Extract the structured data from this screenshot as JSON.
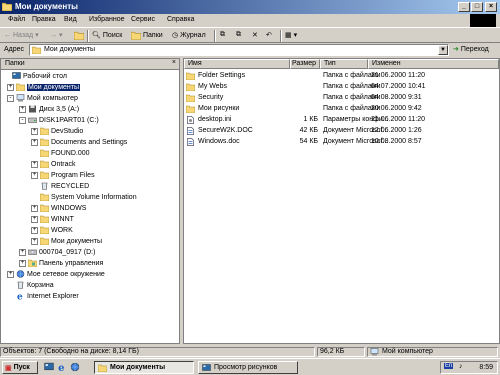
{
  "window": {
    "title": "Мои документы"
  },
  "menu": [
    "Файл",
    "Правка",
    "Вид",
    "Избранное",
    "Сервис",
    "Справка"
  ],
  "toolbar": {
    "back": "Назад",
    "search": "Поиск",
    "folders": "Папки",
    "history": "Журнал"
  },
  "address": {
    "label": "Адрес",
    "value": "Мои документы",
    "go": "Переход"
  },
  "folders_pane": {
    "title": "Папки"
  },
  "tree": [
    {
      "label": "Рабочий стол",
      "icon": "desktop-icon",
      "expander": ""
    },
    {
      "label": "Мои документы",
      "icon": "folder-icon",
      "expander": "+"
    },
    {
      "label": "Мой компьютер",
      "icon": "computer-icon",
      "expander": "-"
    },
    {
      "label": "Диск 3,5 (A:)",
      "icon": "floppy-icon",
      "expander": "+"
    },
    {
      "label": "DISK1PART01 (C:)",
      "icon": "drive-icon",
      "expander": "-"
    },
    {
      "label": "DevStudio",
      "icon": "folder-icon",
      "expander": "+"
    },
    {
      "label": "Documents and Settings",
      "icon": "folder-icon",
      "expander": "+"
    },
    {
      "label": "FOUND.000",
      "icon": "folder-icon",
      "expander": ""
    },
    {
      "label": "Ontrack",
      "icon": "folder-icon",
      "expander": "+"
    },
    {
      "label": "Program Files",
      "icon": "folder-icon",
      "expander": "+"
    },
    {
      "label": "RECYCLED",
      "icon": "recycle-icon",
      "expander": ""
    },
    {
      "label": "System Volume Information",
      "icon": "folder-icon",
      "expander": ""
    },
    {
      "label": "WINDOWS",
      "icon": "folder-icon",
      "expander": "+"
    },
    {
      "label": "WINNT",
      "icon": "folder-icon",
      "expander": "+"
    },
    {
      "label": "WORK",
      "icon": "folder-icon",
      "expander": "+"
    },
    {
      "label": "Мои документы",
      "icon": "folder-icon",
      "expander": "+"
    },
    {
      "label": "000704_0917 (D:)",
      "icon": "cdrom-icon",
      "expander": "+"
    },
    {
      "label": "Панель управления",
      "icon": "control-panel-icon",
      "expander": "+"
    },
    {
      "label": "Мое сетевое окружение",
      "icon": "network-icon",
      "expander": "+"
    },
    {
      "label": "Корзина",
      "icon": "recycle-bin-icon",
      "expander": ""
    },
    {
      "label": "Internet Explorer",
      "icon": "ie-icon",
      "expander": ""
    }
  ],
  "columns": {
    "name": "Имя",
    "size": "Размер",
    "type": "Тип",
    "modified": "Изменен"
  },
  "files": [
    {
      "name": "Folder Settings",
      "size": "",
      "type": "Папка с файлами",
      "modified": "21.06.2000 11:20",
      "icon": "folder-icon"
    },
    {
      "name": "My Webs",
      "size": "",
      "type": "Папка с файлами",
      "modified": "04.07.2000 10:41",
      "icon": "folder-icon"
    },
    {
      "name": "Security",
      "size": "",
      "type": "Папка с файлами",
      "modified": "04.08.2000 9:31",
      "icon": "folder-icon"
    },
    {
      "name": "Мои рисунки",
      "size": "",
      "type": "Папка с файлами",
      "modified": "20.06.2000 9:42",
      "icon": "folder-icon"
    },
    {
      "name": "desktop.ini",
      "size": "1 КБ",
      "type": "Параметры конфи...",
      "modified": "21.06.2000 11:20",
      "icon": "ini-file-icon"
    },
    {
      "name": "SecureW2K.DOC",
      "size": "42 КБ",
      "type": "Документ Microsof...",
      "modified": "12.06.2000 1:26",
      "icon": "word-doc-icon"
    },
    {
      "name": "Windows.doc",
      "size": "54 КБ",
      "type": "Документ Microsof...",
      "modified": "10.08.2000 8:57",
      "icon": "word-doc-icon"
    }
  ],
  "status": {
    "objects": "Объектов: 7 (Свободно на диске: 8,14 ГБ)",
    "size": "96,2 КБ",
    "location": "Мой компьютер"
  },
  "taskbar": {
    "start": "Пуск",
    "task1": "Мои документы",
    "task2": "Просмотр рисунков",
    "clock": "8:59"
  },
  "colors": {
    "title_start": "#0a246a",
    "title_end": "#a6caf0",
    "face": "#d4d0c8",
    "folder": "#f7d775"
  }
}
